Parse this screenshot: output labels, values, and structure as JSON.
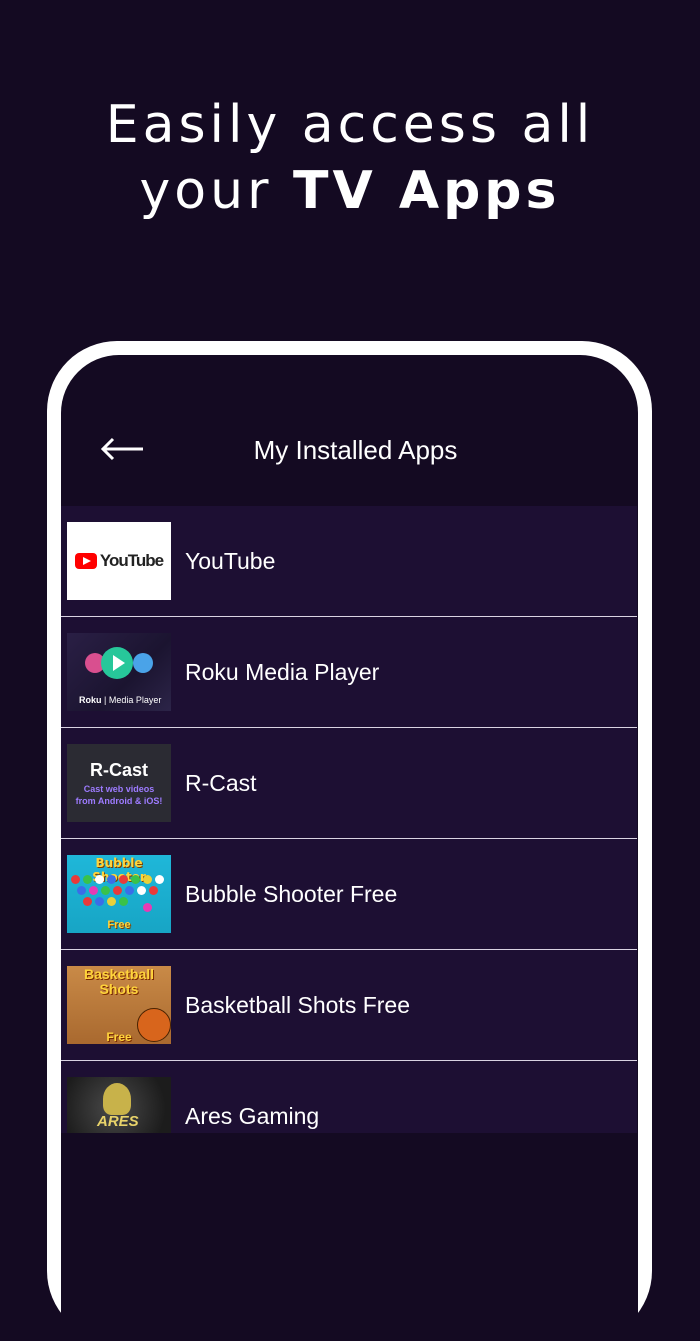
{
  "headline": {
    "line1": "Easily access all",
    "line2_prefix": "your",
    "line2_bold": "TV Apps"
  },
  "screen": {
    "title": "My Installed Apps",
    "back_icon": "arrow-left-icon",
    "apps": [
      {
        "name": "YouTube",
        "thumb_text": "YouTube"
      },
      {
        "name": "Roku Media Player",
        "thumb_brand": "Roku",
        "thumb_text": "Media Player"
      },
      {
        "name": "R-Cast",
        "thumb_title": "R-Cast",
        "thumb_line1": "Cast web videos",
        "thumb_line2": "from Android & iOS!"
      },
      {
        "name": "Bubble Shooter Free",
        "thumb_title": "Bubble Shooter",
        "thumb_free": "Free"
      },
      {
        "name": "Basketball Shots Free",
        "thumb_title1": "Basketball",
        "thumb_title2": "Shots",
        "thumb_free": "Free"
      },
      {
        "name": "Ares Gaming",
        "thumb_text": "ARES"
      }
    ]
  },
  "colors": {
    "background": "#140a22",
    "list_background": "#1d0f33",
    "phone_frame": "#ffffff",
    "divider": "#d9d3e2"
  }
}
